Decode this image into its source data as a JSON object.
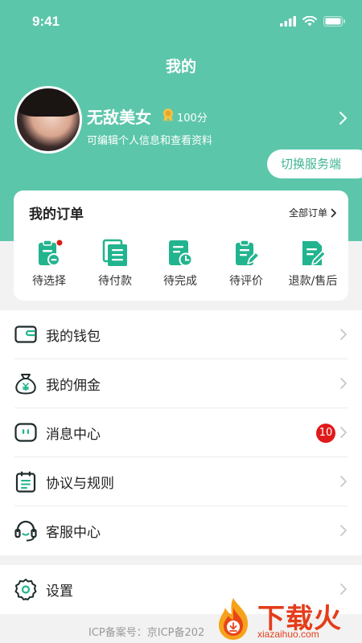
{
  "status_bar": {
    "time": "9:41"
  },
  "header": {
    "title": "我的"
  },
  "profile": {
    "name": "无敌美女",
    "points": "100分",
    "subtitle": "可编辑个人信息和查看资料",
    "switch_label": "切换服务端"
  },
  "orders": {
    "title": "我的订单",
    "all_label": "全部订单",
    "items": [
      {
        "label": "待选择",
        "icon": "clipboard-minus-icon",
        "has_dot": true
      },
      {
        "label": "待付款",
        "icon": "document-stack-icon"
      },
      {
        "label": "待完成",
        "icon": "document-clock-icon"
      },
      {
        "label": "待评价",
        "icon": "clipboard-edit-icon"
      },
      {
        "label": "退款/售后",
        "icon": "document-pencil-icon"
      }
    ]
  },
  "menu": {
    "items": [
      {
        "label": "我的钱包",
        "icon": "wallet-icon"
      },
      {
        "label": "我的佣金",
        "icon": "money-bag-icon"
      },
      {
        "label": "消息中心",
        "icon": "message-icon",
        "badge": "10"
      },
      {
        "label": "协议与规则",
        "icon": "calendar-list-icon"
      },
      {
        "label": "客服中心",
        "icon": "headset-icon"
      }
    ],
    "settings": {
      "label": "设置",
      "icon": "gear-icon"
    }
  },
  "footer": {
    "icp": "ICP备案号：京ICP备202"
  },
  "watermark": {
    "text": "下载火",
    "domain": "xiazaihuo.com"
  },
  "colors": {
    "primary": "#5cc6aa",
    "accent_text": "#3fb594",
    "badge": "#e01a1a",
    "icon_green": "#22b48e"
  }
}
